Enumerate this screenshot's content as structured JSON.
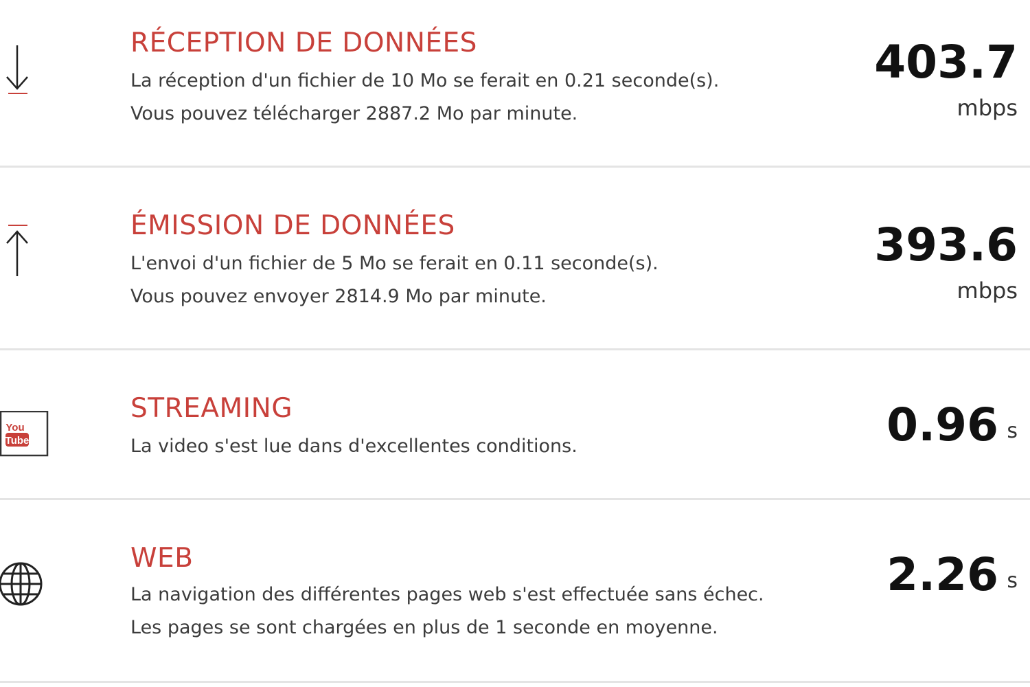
{
  "rows": [
    {
      "title": "RÉCEPTION DE DONNÉES",
      "line1": "La réception d'un fichier de 10 Mo se ferait en 0.21 seconde(s).",
      "line2": "Vous pouvez télécharger 2887.2 Mo par minute.",
      "value": "403.7",
      "unit": "mbps",
      "icon": "download-arrow-icon"
    },
    {
      "title": "ÉMISSION DE DONNÉES",
      "line1": "L'envoi d'un fichier de 5 Mo se ferait en 0.11 seconde(s).",
      "line2": "Vous pouvez envoyer 2814.9 Mo par minute.",
      "value": "393.6",
      "unit": "mbps",
      "icon": "upload-arrow-icon"
    },
    {
      "title": "STREAMING",
      "line1": "La video s'est lue dans d'excellentes conditions.",
      "value": "0.96",
      "unit": "s",
      "icon": "youtube-icon",
      "icon_text_top": "You",
      "icon_text_bottom": "Tube"
    },
    {
      "title": "WEB",
      "line1": "La navigation des différentes pages web s'est effectuée sans échec.",
      "line2": "Les pages se sont chargées en plus de 1 seconde en moyenne.",
      "value": "2.26",
      "unit": "s",
      "icon": "globe-icon"
    }
  ],
  "colors": {
    "accent": "#c8403a",
    "text": "#3c3c3c",
    "value": "#111111",
    "divider": "#e4e4e4"
  }
}
